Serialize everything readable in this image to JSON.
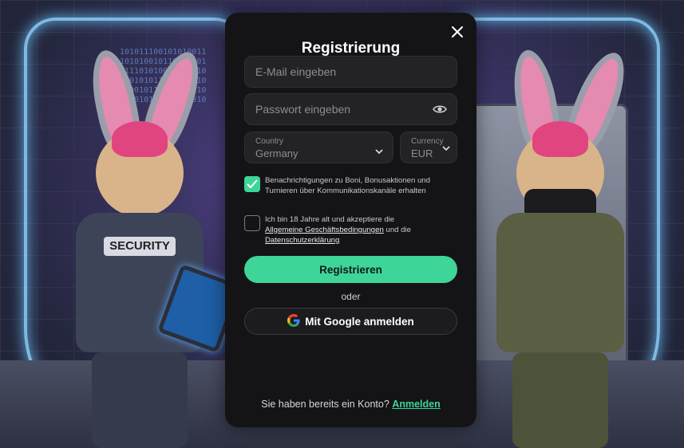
{
  "background": {
    "badge_text": "SECURITY",
    "code_rain": "10101110010101001110101001011010100101110101001010111010010101110100101011001011010110101001101010100101101011"
  },
  "modal": {
    "title": "Registrierung",
    "email_placeholder": "E-Mail eingeben",
    "password_placeholder": "Passwort eingeben",
    "country": {
      "label": "Country",
      "value": "Germany"
    },
    "currency": {
      "label": "Currency",
      "value": "EUR"
    },
    "notifications_checked": true,
    "notifications_text": "Benachrichtigungen zu Boni, Bonusaktionen und Turnieren über Kommunikationskanäle erhalten",
    "age_checked": false,
    "age_text_prefix": "Ich bin 18 Jahre alt und akzeptiere die",
    "terms_link": "Allgemeine Geschäftsbedingungen",
    "and_text": "und die",
    "privacy_link": "Datenschutzerklärung",
    "register_label": "Registrieren",
    "or_text": "oder",
    "google_label": "Mit Google anmelden",
    "footer_text": "Sie haben bereits ein Konto?",
    "login_link": "Anmelden"
  },
  "colors": {
    "accent": "#3ed598",
    "modal_bg": "#141416",
    "field_bg": "#232326"
  }
}
